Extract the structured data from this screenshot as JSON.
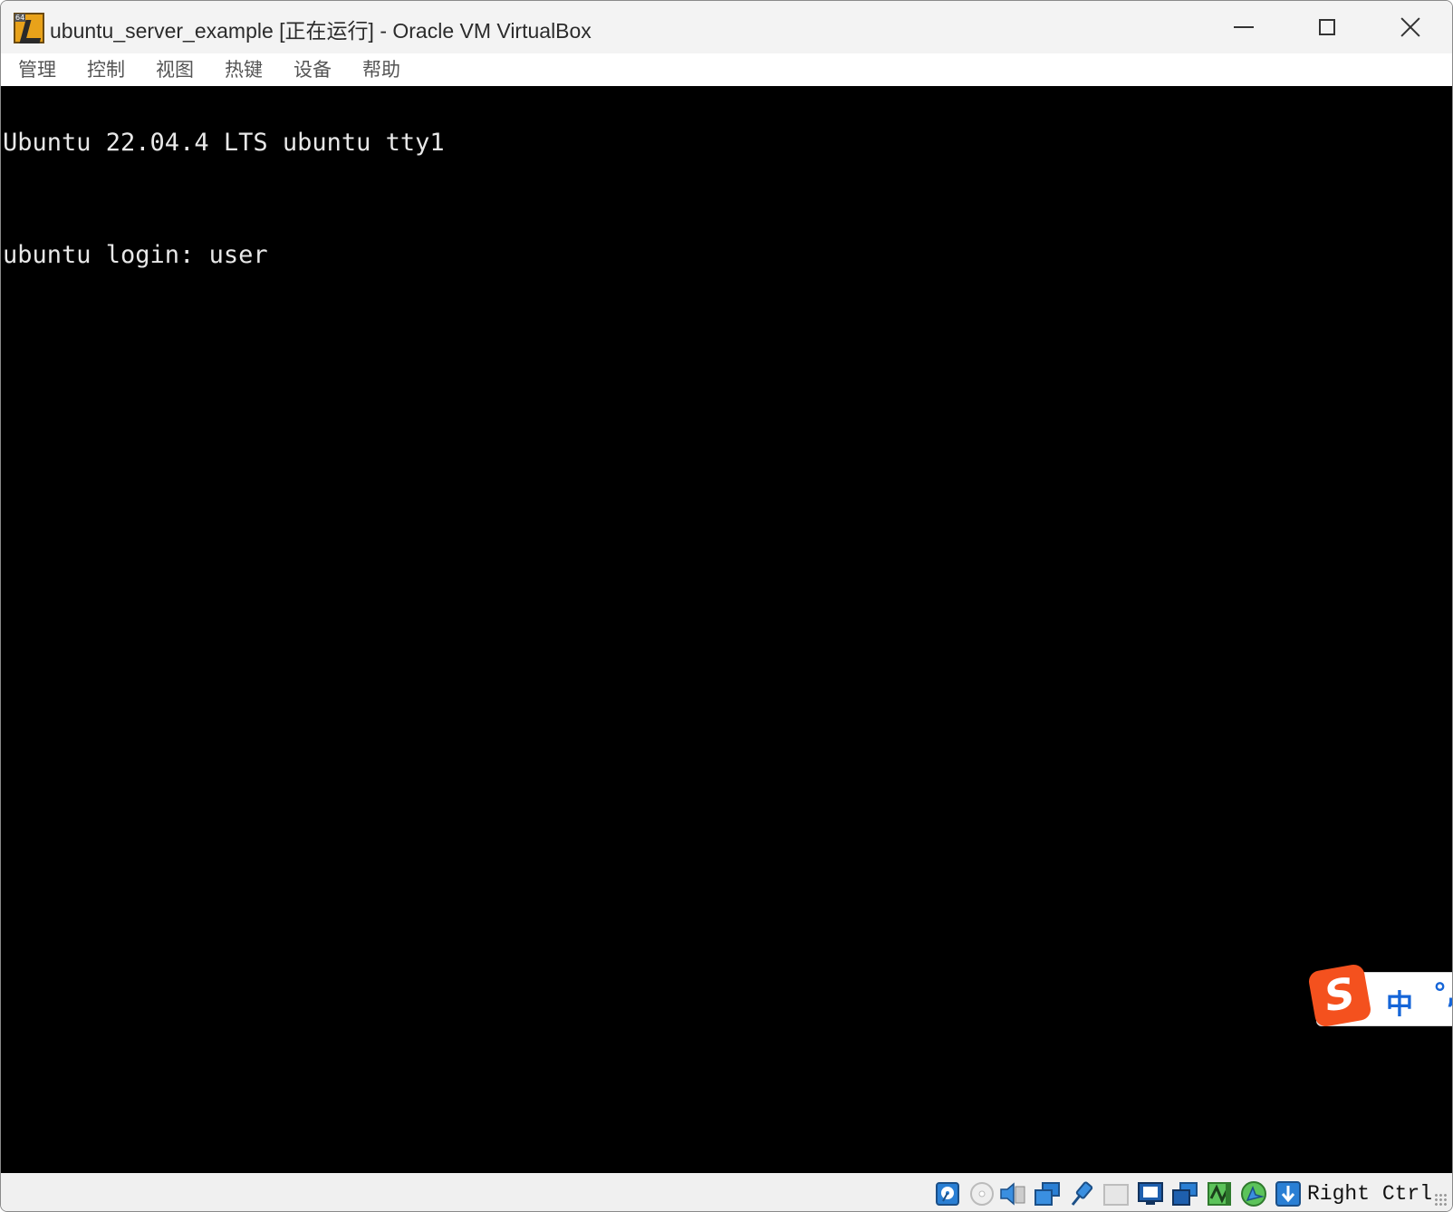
{
  "window": {
    "title": "ubuntu_server_example [正在运行] - Oracle VM VirtualBox",
    "app_icon": "virtualbox-vm-64bit-icon",
    "app_icon_badge": "64",
    "controls": [
      "minimize-icon",
      "maximize-icon",
      "close-icon"
    ]
  },
  "menu": {
    "items": [
      {
        "label": "管理"
      },
      {
        "label": "控制"
      },
      {
        "label": "视图"
      },
      {
        "label": "热键"
      },
      {
        "label": "设备"
      },
      {
        "label": "帮助"
      }
    ]
  },
  "console": {
    "lines": [
      "Ubuntu 22.04.4 LTS ubuntu tty1",
      "",
      "ubuntu login: user"
    ],
    "background": "#000000",
    "foreground": "#e8e8e8"
  },
  "ime": {
    "logo": "S",
    "mode": "中",
    "punctuation": "°,",
    "accent": "#f4511e",
    "text_color": "#1565d8"
  },
  "statusbar": {
    "icons": [
      "hard-disk-icon",
      "optical-drive-icon",
      "audio-icon",
      "network-icon",
      "usb-icon",
      "shared-folders-icon",
      "display-icon",
      "recording-icon",
      "cpu-activity-icon",
      "mouse-integration-icon",
      "keyboard-capture-icon"
    ],
    "host_key": "Right Ctrl"
  }
}
